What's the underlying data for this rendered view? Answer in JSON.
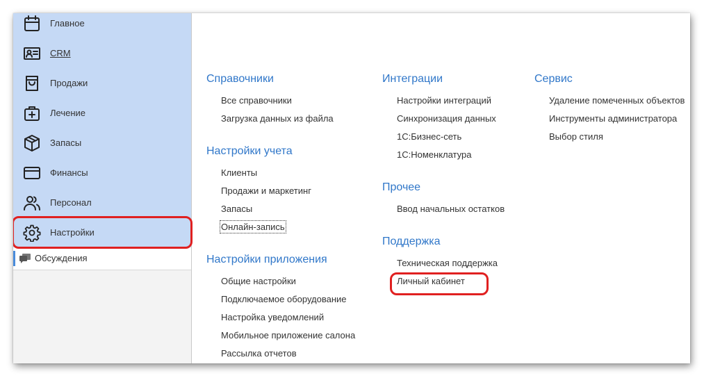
{
  "sidebar": {
    "items": [
      {
        "label": "Главное",
        "icon": "calendar-icon"
      },
      {
        "label": "CRM",
        "icon": "contact-card-icon"
      },
      {
        "label": "Продажи",
        "icon": "shopping-bag-icon"
      },
      {
        "label": "Лечение",
        "icon": "medical-bag-icon"
      },
      {
        "label": "Запасы",
        "icon": "box-icon"
      },
      {
        "label": "Финансы",
        "icon": "credit-card-icon"
      },
      {
        "label": "Персонал",
        "icon": "users-icon"
      },
      {
        "label": "Настройки",
        "icon": "gear-icon"
      }
    ],
    "discussions": {
      "label": "Обсуждения",
      "icon": "chat-icon"
    }
  },
  "sections": {
    "references": {
      "title": "Справочники",
      "items": [
        "Все справочники",
        "Загрузка данных из файла"
      ]
    },
    "accounting": {
      "title": "Настройки учета",
      "items": [
        "Клиенты",
        "Продажи и маркетинг",
        "Запасы",
        "Онлайн-запись"
      ]
    },
    "app_settings": {
      "title": "Настройки приложения",
      "items": [
        "Общие настройки",
        "Подключаемое оборудование",
        "Настройка уведомлений",
        "Мобильное приложение салона",
        "Рассылка отчетов"
      ]
    },
    "integrations": {
      "title": "Интеграции",
      "items": [
        "Настройки интеграций",
        "Синхронизация данных",
        "1С:Бизнес-сеть",
        "1С:Номенклатура"
      ]
    },
    "other": {
      "title": "Прочее",
      "items": [
        "Ввод начальных остатков"
      ]
    },
    "support": {
      "title": "Поддержка",
      "items": [
        "Техническая поддержка",
        "Личный кабинет"
      ]
    },
    "service": {
      "title": "Сервис",
      "items": [
        "Удаление помеченных объектов",
        "Инструменты администратора",
        "Выбор стиля"
      ]
    }
  },
  "colors": {
    "sidebar_active_bg": "#c5d9f5",
    "section_title": "#3077c9",
    "highlight": "#e02020",
    "text": "#333333"
  }
}
